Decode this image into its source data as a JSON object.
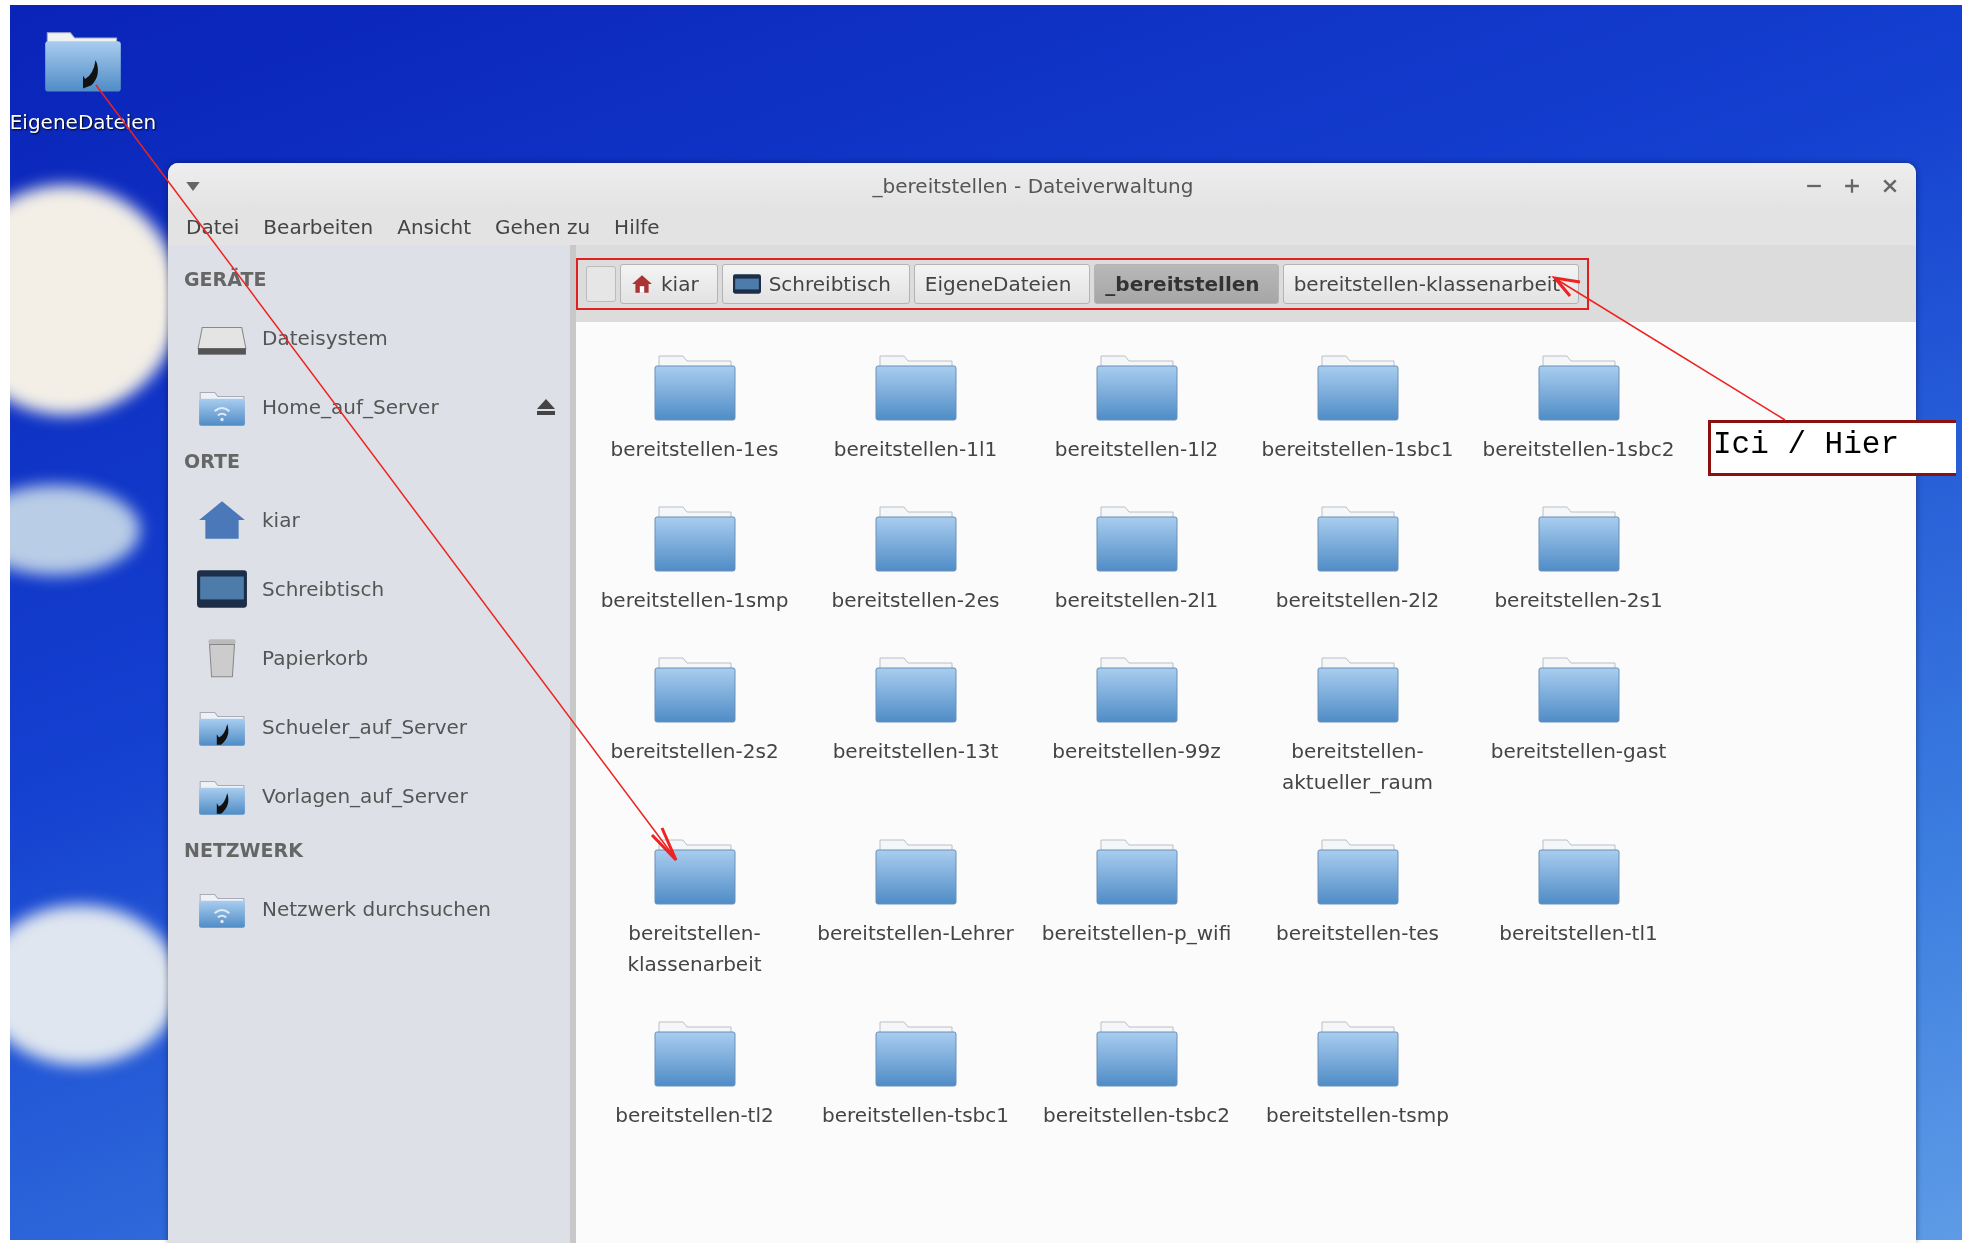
{
  "desktop": {
    "icons": [
      {
        "label": "EigeneDateien"
      }
    ]
  },
  "window": {
    "title": "_bereitstellen - Dateiverwaltung",
    "menu": [
      "Datei",
      "Bearbeiten",
      "Ansicht",
      "Gehen zu",
      "Hilfe"
    ]
  },
  "breadcrumb": [
    {
      "label": "kiar",
      "kind": "home",
      "selected": false
    },
    {
      "label": "Schreibtisch",
      "kind": "desktop",
      "selected": false
    },
    {
      "label": "EigeneDateien",
      "kind": "plain",
      "selected": false
    },
    {
      "label": "_bereitstellen",
      "kind": "plain",
      "selected": true
    },
    {
      "label": "bereitstellen-klassenarbeit",
      "kind": "plain",
      "selected": false
    }
  ],
  "sidebar": {
    "sections": [
      {
        "heading": "GERÄTE",
        "items": [
          {
            "label": "Dateisystem",
            "kind": "drive",
            "eject": false
          },
          {
            "label": "Home_auf_Server",
            "kind": "network",
            "eject": true
          }
        ]
      },
      {
        "heading": "ORTE",
        "items": [
          {
            "label": "kiar",
            "kind": "home",
            "eject": false
          },
          {
            "label": "Schreibtisch",
            "kind": "desktop",
            "eject": false
          },
          {
            "label": "Papierkorb",
            "kind": "trash",
            "eject": false
          },
          {
            "label": "Schueler_auf_Server",
            "kind": "link",
            "eject": false
          },
          {
            "label": "Vorlagen_auf_Server",
            "kind": "link",
            "eject": false
          }
        ]
      },
      {
        "heading": "NETZWERK",
        "items": [
          {
            "label": "Netzwerk durchsuchen",
            "kind": "network",
            "eject": false
          }
        ]
      }
    ]
  },
  "files": [
    "bereitstellen-1es",
    "bereitstellen-1l1",
    "bereitstellen-1l2",
    "bereitstellen-1sbc1",
    "bereitstellen-1sbc2",
    "bereitstellen-1smp",
    "bereitstellen-2es",
    "bereitstellen-2l1",
    "bereitstellen-2l2",
    "bereitstellen-2s1",
    "bereitstellen-2s2",
    "bereitstellen-13t",
    "bereitstellen-99z",
    "bereitstellen-aktueller_raum",
    "bereitstellen-gast",
    "bereitstellen-klassenarbeit",
    "bereitstellen-Lehrer",
    "bereitstellen-p_wifi",
    "bereitstellen-tes",
    "bereitstellen-tl1",
    "bereitstellen-tl2",
    "bereitstellen-tsbc1",
    "bereitstellen-tsbc2",
    "bereitstellen-tsmp"
  ],
  "annotation": {
    "label": "Ici / Hier"
  }
}
